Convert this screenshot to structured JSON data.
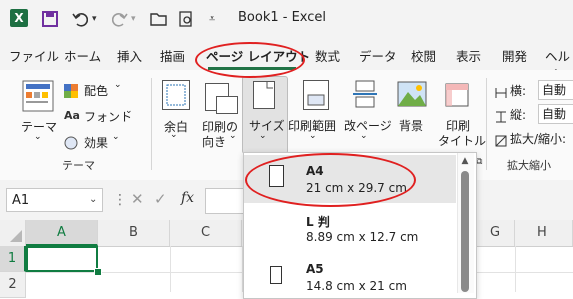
{
  "app": {
    "logo_letter": "X",
    "window_title": "Book1 - Excel"
  },
  "quick_access": {
    "icons": [
      "save-icon",
      "undo-icon",
      "undo-dropdown-icon",
      "redo-icon",
      "redo-dropdown-icon",
      "open-folder-icon",
      "print-preview-icon",
      "customize-qat-icon"
    ]
  },
  "menu": {
    "tabs": [
      "ファイル",
      "ホーム",
      "挿入",
      "描画",
      "ページ レイアウト",
      "数式",
      "データ",
      "校閲",
      "表示",
      "開発",
      "ヘルプ"
    ]
  },
  "ribbon": {
    "theme_group": {
      "theme_button": "テーマ",
      "colors": "配色",
      "fonts": "フォント",
      "effects": "効果",
      "group_label": "テーマ"
    },
    "page_setup": {
      "margins": "余白",
      "orientation_line1": "印刷の",
      "orientation_line2": "向き",
      "size": "サイズ",
      "print_area": "印刷範囲",
      "breaks": "改ページ",
      "background": "背景",
      "print_titles_line1": "印刷",
      "print_titles_line2": "タイトル"
    },
    "scale_group": {
      "width_label": "横:",
      "width_value": "自動",
      "height_label": "縦:",
      "height_value": "自動",
      "scale_label": "拡大/縮小:",
      "group_label": "拡大縮小"
    }
  },
  "formula_bar": {
    "name_box": "A1",
    "fx": "fx"
  },
  "grid": {
    "columns": [
      "A",
      "B",
      "C",
      "G",
      "H"
    ],
    "rows": [
      "1",
      "2"
    ]
  },
  "size_dropdown": {
    "items": [
      {
        "name": "A4",
        "dims": "21 cm x 29.7 cm"
      },
      {
        "name": "L 判",
        "dims": "8.89 cm x 12.7 cm"
      },
      {
        "name": "A5",
        "dims": "14.8 cm x 21 cm"
      }
    ]
  },
  "colors": {
    "excel_green": "#107c41",
    "annotation_red": "#e02020"
  }
}
